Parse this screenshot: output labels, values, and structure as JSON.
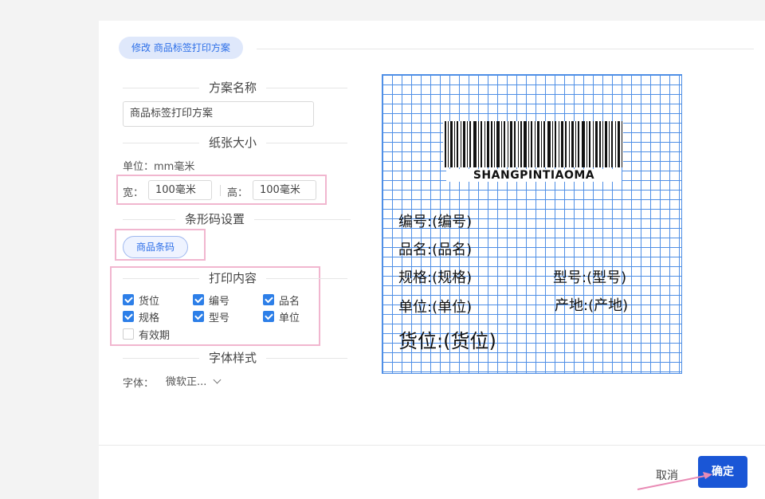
{
  "title": "修改 商品标签打印方案",
  "sections": {
    "scheme_name": {
      "heading": "方案名称",
      "value": "商品标签打印方案"
    },
    "paper_size": {
      "heading": "纸张大小",
      "unit_label": "单位：mm毫米",
      "width_label": "宽：",
      "width_value": "100毫米",
      "height_label": "高：",
      "height_value": "100毫米"
    },
    "barcode": {
      "heading": "条形码设置",
      "chip_label": "商品条码"
    },
    "print_content": {
      "heading": "打印内容",
      "options": [
        {
          "label": "货位",
          "checked": true
        },
        {
          "label": "编号",
          "checked": true
        },
        {
          "label": "品名",
          "checked": true
        },
        {
          "label": "规格",
          "checked": true
        },
        {
          "label": "型号",
          "checked": true
        },
        {
          "label": "单位",
          "checked": true
        },
        {
          "label": "有效期",
          "checked": false
        }
      ]
    },
    "font_style": {
      "heading": "字体样式",
      "font_label": "字体：",
      "font_value": "微软正..."
    }
  },
  "preview": {
    "barcode_text": "SHANGPINTIAOMA",
    "fields": {
      "bianhao": "编号:(编号)",
      "pinming": "品名:(品名)",
      "guige": "规格:(规格)",
      "xinghao": "型号:(型号)",
      "danwei": "单位:(单位)",
      "chandi": "产地:(产地)",
      "huowei": "货位:(货位)"
    }
  },
  "footer": {
    "cancel_label": "取消",
    "ok_label": "确定"
  },
  "colors": {
    "accent": "#1a56d6",
    "grid": "#4f8fe6",
    "highlight": "#f1b6cf",
    "arrow": "#e98bb5"
  }
}
